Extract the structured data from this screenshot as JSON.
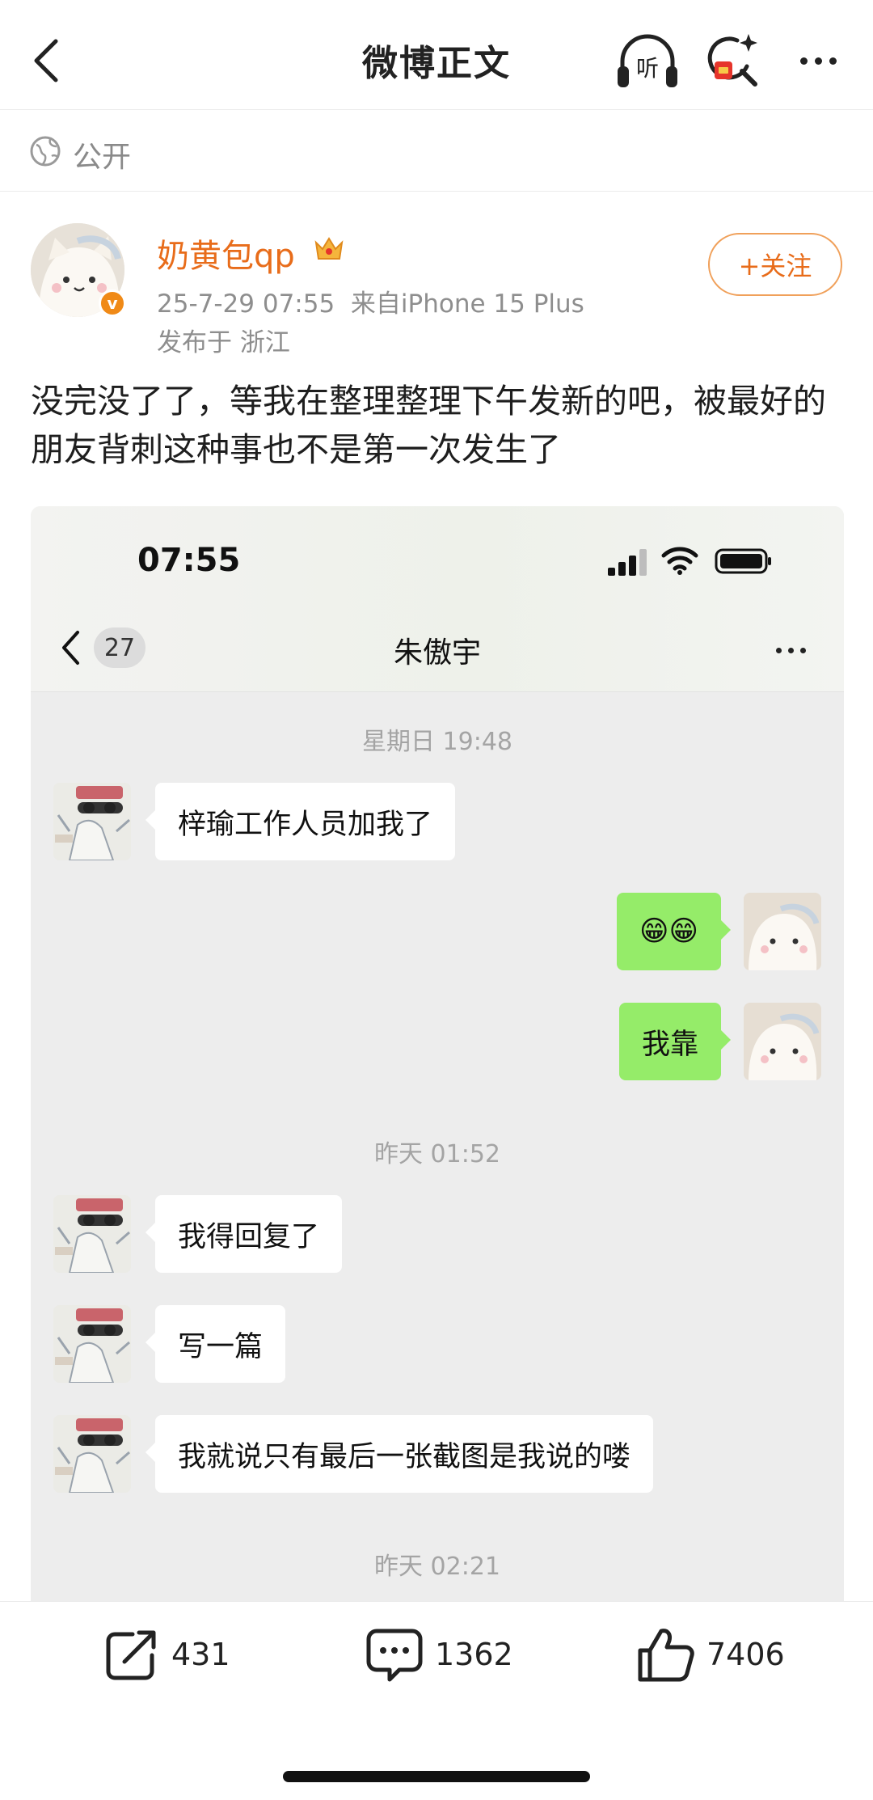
{
  "nav": {
    "title": "微博正文",
    "listen_label": "听"
  },
  "visibility": {
    "label": "公开"
  },
  "author": {
    "name": "奶黄包qp",
    "badge": "v",
    "time": "25-7-29 07:55",
    "source": "来自iPhone 15 Plus",
    "location": "发布于 浙江",
    "follow_label": "+关注"
  },
  "post": {
    "text": "没完没了了，等我在整理整理下午发新的吧，被最好的朋友背刺这种事也不是第一次发生了"
  },
  "screenshot": {
    "status_time": "07:55",
    "unread_count": "27",
    "chat_title": "朱傲宇",
    "timestamps": [
      "星期日 19:48",
      "昨天 01:52",
      "昨天 02:21"
    ],
    "messages": [
      {
        "side": "in",
        "text": "梓瑜工作人员加我了"
      },
      {
        "side": "out",
        "text": "😁😁"
      },
      {
        "side": "out",
        "text": "我靠"
      },
      {
        "side": "in",
        "text": "我得回复了"
      },
      {
        "side": "in",
        "text": "写一篇"
      },
      {
        "side": "in",
        "text": "我就说只有最后一张截图是我说的喽"
      }
    ]
  },
  "actions": {
    "repost_count": "431",
    "comment_count": "1362",
    "like_count": "7406"
  },
  "colors": {
    "accent": "#e86c1a",
    "bubble_out": "#95ec69",
    "chat_bg": "#ededed"
  },
  "icons": [
    "back-icon",
    "headphones-icon",
    "ai-search-icon",
    "more-icon",
    "globe-icon",
    "crown-icon",
    "signal-icon",
    "wifi-icon",
    "battery-icon",
    "repost-icon",
    "comment-icon",
    "like-icon"
  ]
}
